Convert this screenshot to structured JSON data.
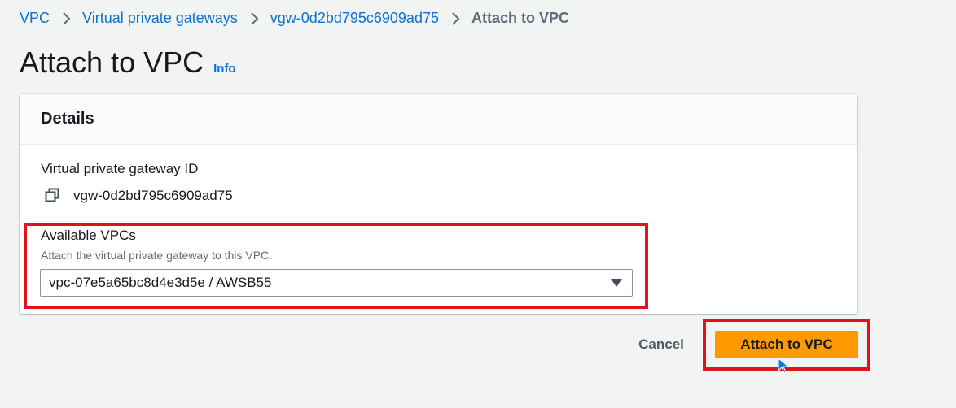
{
  "breadcrumb": {
    "items": [
      {
        "label": "VPC"
      },
      {
        "label": "Virtual private gateways"
      },
      {
        "label": "vgw-0d2bd795c6909ad75"
      }
    ],
    "current": "Attach to VPC"
  },
  "page": {
    "title": "Attach to VPC",
    "info_label": "Info"
  },
  "details": {
    "heading": "Details",
    "gateway_id_label": "Virtual private gateway ID",
    "gateway_id_value": "vgw-0d2bd795c6909ad75",
    "copy_icon": "copy-icon",
    "vpc_label": "Available VPCs",
    "vpc_description": "Attach the virtual private gateway to this VPC.",
    "vpc_selected": "vpc-07e5a65bc8d4e3d5e / AWSB55"
  },
  "actions": {
    "cancel_label": "Cancel",
    "attach_label": "Attach to VPC"
  },
  "colors": {
    "link": "#0972d3",
    "primary_button": "#ff9900",
    "highlight": "#e0131c"
  }
}
